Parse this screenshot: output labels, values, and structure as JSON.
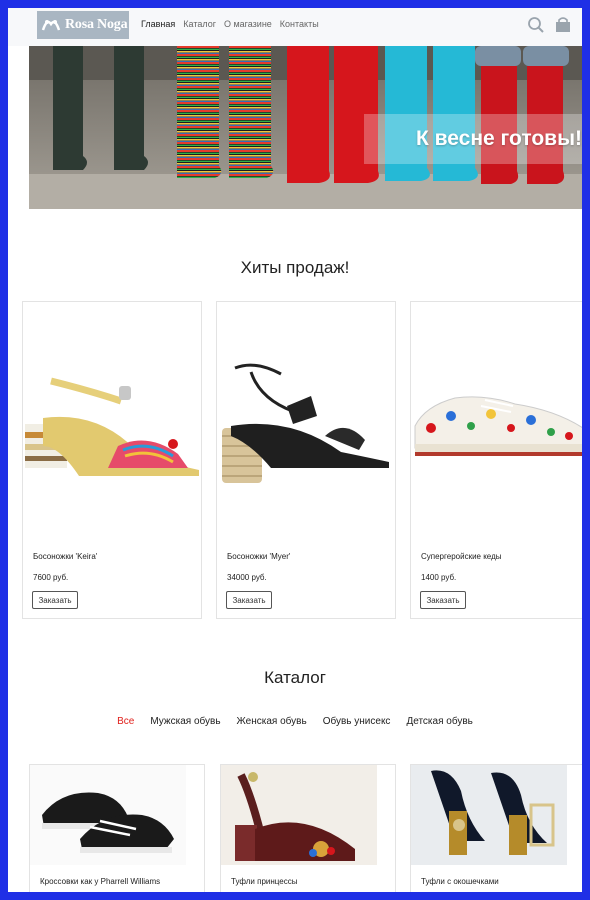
{
  "header": {
    "logo_text": "Rosa Noga",
    "nav": [
      "Главная",
      "Каталог",
      "О магазине",
      "Контакты"
    ],
    "search_icon": "search-icon",
    "cart_icon": "shopping-bag-icon"
  },
  "hero": {
    "headline": "К весне готовы!"
  },
  "hits": {
    "title": "Хиты продаж!",
    "products": [
      {
        "name": "Босоножки 'Keira'",
        "price": "7600 руб.",
        "button": "Заказать"
      },
      {
        "name": "Босоножки 'Myer'",
        "price": "34000 руб.",
        "button": "Заказать"
      },
      {
        "name": "Супергеройские кеды",
        "price": "1400 руб.",
        "button": "Заказать"
      }
    ]
  },
  "catalog": {
    "title": "Каталог",
    "filters": [
      "Все",
      "Мужская обувь",
      "Женская обувь",
      "Обувь унисекс",
      "Детская обувь"
    ],
    "products": [
      {
        "name": "Кроссовки как у Pharrell Williams"
      },
      {
        "name": "Туфли принцессы"
      },
      {
        "name": "Туфли с окошечками"
      }
    ]
  },
  "colors": {
    "frame": "#1f2fe6",
    "active_filter": "#e0201b",
    "logo_bg": "#a9b6c2"
  }
}
